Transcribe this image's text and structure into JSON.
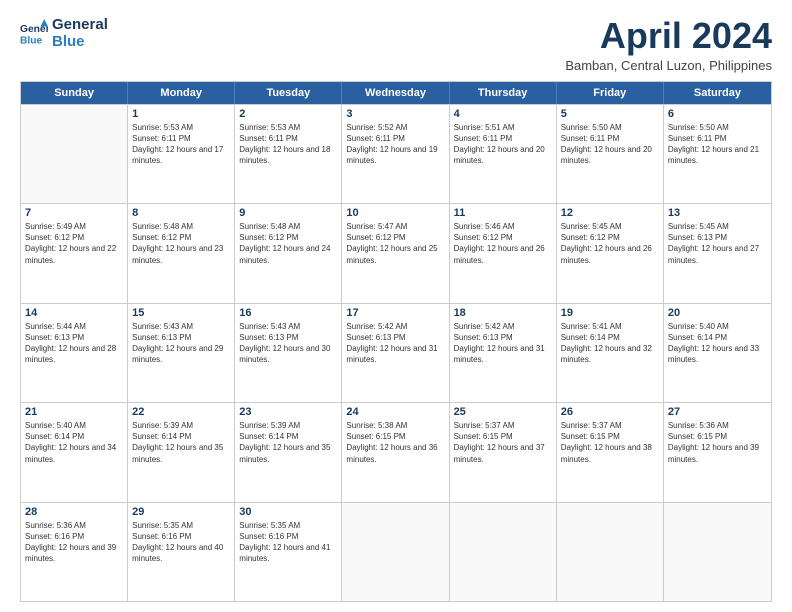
{
  "logo": {
    "line1": "General",
    "line2": "Blue"
  },
  "title": "April 2024",
  "location": "Bamban, Central Luzon, Philippines",
  "header": {
    "days": [
      "Sunday",
      "Monday",
      "Tuesday",
      "Wednesday",
      "Thursday",
      "Friday",
      "Saturday"
    ]
  },
  "rows": [
    [
      {
        "day": "",
        "sunrise": "",
        "sunset": "",
        "daylight": ""
      },
      {
        "day": "1",
        "sunrise": "Sunrise: 5:53 AM",
        "sunset": "Sunset: 6:11 PM",
        "daylight": "Daylight: 12 hours and 17 minutes."
      },
      {
        "day": "2",
        "sunrise": "Sunrise: 5:53 AM",
        "sunset": "Sunset: 6:11 PM",
        "daylight": "Daylight: 12 hours and 18 minutes."
      },
      {
        "day": "3",
        "sunrise": "Sunrise: 5:52 AM",
        "sunset": "Sunset: 6:11 PM",
        "daylight": "Daylight: 12 hours and 19 minutes."
      },
      {
        "day": "4",
        "sunrise": "Sunrise: 5:51 AM",
        "sunset": "Sunset: 6:11 PM",
        "daylight": "Daylight: 12 hours and 20 minutes."
      },
      {
        "day": "5",
        "sunrise": "Sunrise: 5:50 AM",
        "sunset": "Sunset: 6:11 PM",
        "daylight": "Daylight: 12 hours and 20 minutes."
      },
      {
        "day": "6",
        "sunrise": "Sunrise: 5:50 AM",
        "sunset": "Sunset: 6:11 PM",
        "daylight": "Daylight: 12 hours and 21 minutes."
      }
    ],
    [
      {
        "day": "7",
        "sunrise": "Sunrise: 5:49 AM",
        "sunset": "Sunset: 6:12 PM",
        "daylight": "Daylight: 12 hours and 22 minutes."
      },
      {
        "day": "8",
        "sunrise": "Sunrise: 5:48 AM",
        "sunset": "Sunset: 6:12 PM",
        "daylight": "Daylight: 12 hours and 23 minutes."
      },
      {
        "day": "9",
        "sunrise": "Sunrise: 5:48 AM",
        "sunset": "Sunset: 6:12 PM",
        "daylight": "Daylight: 12 hours and 24 minutes."
      },
      {
        "day": "10",
        "sunrise": "Sunrise: 5:47 AM",
        "sunset": "Sunset: 6:12 PM",
        "daylight": "Daylight: 12 hours and 25 minutes."
      },
      {
        "day": "11",
        "sunrise": "Sunrise: 5:46 AM",
        "sunset": "Sunset: 6:12 PM",
        "daylight": "Daylight: 12 hours and 26 minutes."
      },
      {
        "day": "12",
        "sunrise": "Sunrise: 5:45 AM",
        "sunset": "Sunset: 6:12 PM",
        "daylight": "Daylight: 12 hours and 26 minutes."
      },
      {
        "day": "13",
        "sunrise": "Sunrise: 5:45 AM",
        "sunset": "Sunset: 6:13 PM",
        "daylight": "Daylight: 12 hours and 27 minutes."
      }
    ],
    [
      {
        "day": "14",
        "sunrise": "Sunrise: 5:44 AM",
        "sunset": "Sunset: 6:13 PM",
        "daylight": "Daylight: 12 hours and 28 minutes."
      },
      {
        "day": "15",
        "sunrise": "Sunrise: 5:43 AM",
        "sunset": "Sunset: 6:13 PM",
        "daylight": "Daylight: 12 hours and 29 minutes."
      },
      {
        "day": "16",
        "sunrise": "Sunrise: 5:43 AM",
        "sunset": "Sunset: 6:13 PM",
        "daylight": "Daylight: 12 hours and 30 minutes."
      },
      {
        "day": "17",
        "sunrise": "Sunrise: 5:42 AM",
        "sunset": "Sunset: 6:13 PM",
        "daylight": "Daylight: 12 hours and 31 minutes."
      },
      {
        "day": "18",
        "sunrise": "Sunrise: 5:42 AM",
        "sunset": "Sunset: 6:13 PM",
        "daylight": "Daylight: 12 hours and 31 minutes."
      },
      {
        "day": "19",
        "sunrise": "Sunrise: 5:41 AM",
        "sunset": "Sunset: 6:14 PM",
        "daylight": "Daylight: 12 hours and 32 minutes."
      },
      {
        "day": "20",
        "sunrise": "Sunrise: 5:40 AM",
        "sunset": "Sunset: 6:14 PM",
        "daylight": "Daylight: 12 hours and 33 minutes."
      }
    ],
    [
      {
        "day": "21",
        "sunrise": "Sunrise: 5:40 AM",
        "sunset": "Sunset: 6:14 PM",
        "daylight": "Daylight: 12 hours and 34 minutes."
      },
      {
        "day": "22",
        "sunrise": "Sunrise: 5:39 AM",
        "sunset": "Sunset: 6:14 PM",
        "daylight": "Daylight: 12 hours and 35 minutes."
      },
      {
        "day": "23",
        "sunrise": "Sunrise: 5:39 AM",
        "sunset": "Sunset: 6:14 PM",
        "daylight": "Daylight: 12 hours and 35 minutes."
      },
      {
        "day": "24",
        "sunrise": "Sunrise: 5:38 AM",
        "sunset": "Sunset: 6:15 PM",
        "daylight": "Daylight: 12 hours and 36 minutes."
      },
      {
        "day": "25",
        "sunrise": "Sunrise: 5:37 AM",
        "sunset": "Sunset: 6:15 PM",
        "daylight": "Daylight: 12 hours and 37 minutes."
      },
      {
        "day": "26",
        "sunrise": "Sunrise: 5:37 AM",
        "sunset": "Sunset: 6:15 PM",
        "daylight": "Daylight: 12 hours and 38 minutes."
      },
      {
        "day": "27",
        "sunrise": "Sunrise: 5:36 AM",
        "sunset": "Sunset: 6:15 PM",
        "daylight": "Daylight: 12 hours and 39 minutes."
      }
    ],
    [
      {
        "day": "28",
        "sunrise": "Sunrise: 5:36 AM",
        "sunset": "Sunset: 6:16 PM",
        "daylight": "Daylight: 12 hours and 39 minutes."
      },
      {
        "day": "29",
        "sunrise": "Sunrise: 5:35 AM",
        "sunset": "Sunset: 6:16 PM",
        "daylight": "Daylight: 12 hours and 40 minutes."
      },
      {
        "day": "30",
        "sunrise": "Sunrise: 5:35 AM",
        "sunset": "Sunset: 6:16 PM",
        "daylight": "Daylight: 12 hours and 41 minutes."
      },
      {
        "day": "",
        "sunrise": "",
        "sunset": "",
        "daylight": ""
      },
      {
        "day": "",
        "sunrise": "",
        "sunset": "",
        "daylight": ""
      },
      {
        "day": "",
        "sunrise": "",
        "sunset": "",
        "daylight": ""
      },
      {
        "day": "",
        "sunrise": "",
        "sunset": "",
        "daylight": ""
      }
    ]
  ]
}
